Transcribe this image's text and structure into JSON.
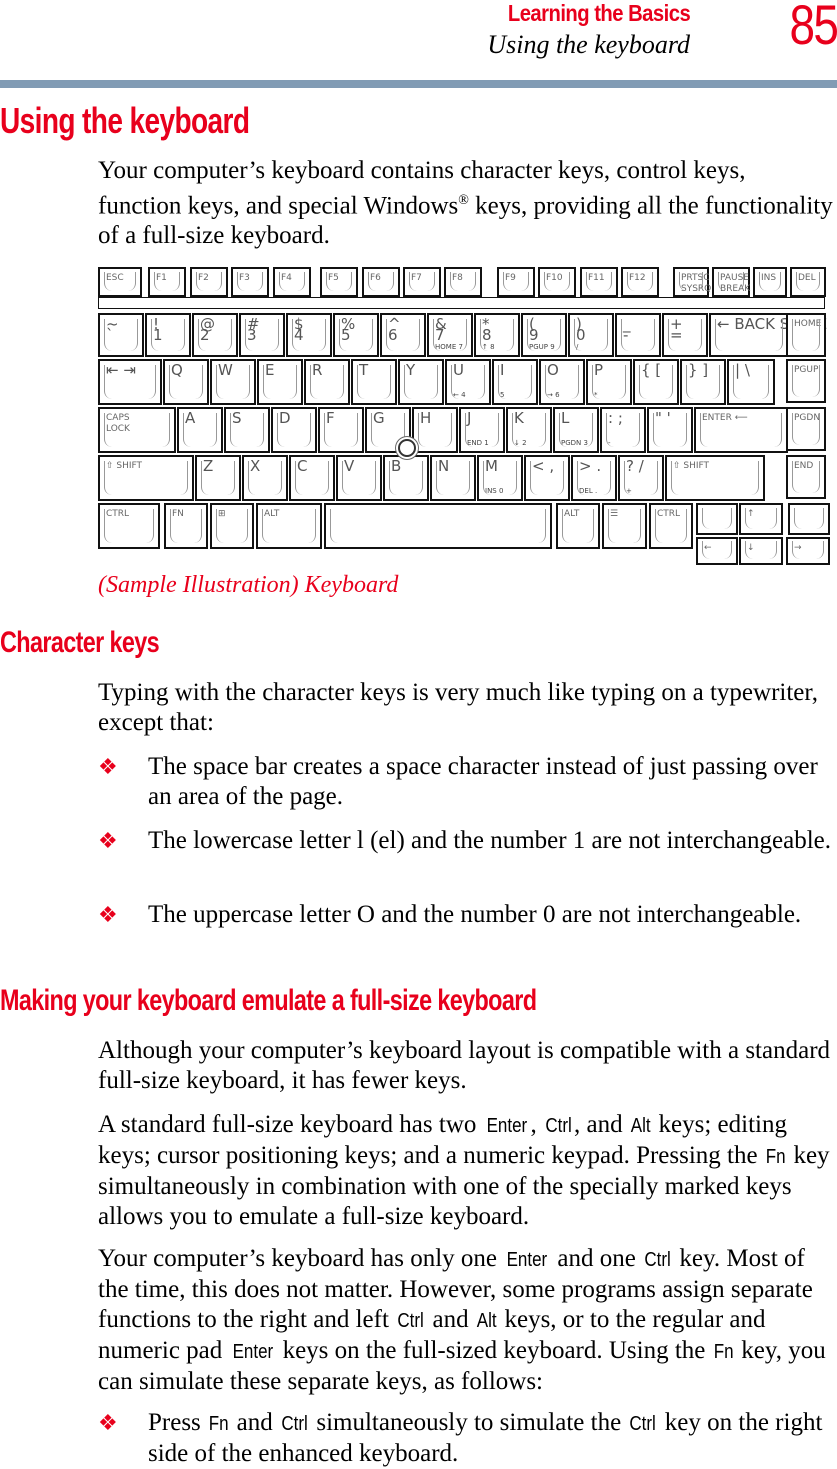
{
  "header": {
    "section": "Learning the Basics",
    "subsection": "Using the keyboard",
    "page_number": "85"
  },
  "colors": {
    "accent": "#e8001c",
    "rule": "#819bb4"
  },
  "main": {
    "title": "Using the keyboard",
    "intro_before": "Your computer’s keyboard contains character keys, control keys, function keys, and special Windows",
    "intro_reg": "®",
    "intro_after": " keys, providing all the functionality of a full-size keyboard.",
    "caption": "(Sample Illustration) Keyboard",
    "keyboard": {
      "function_row": [
        "ESC",
        "F1",
        "F2",
        "F3",
        "F4",
        "F5",
        "F6",
        "F7",
        "F8",
        "F9",
        "F10",
        "F11",
        "F12",
        "PRTSC\nSYSRQ",
        "PAUSE\nBREAK",
        "INS",
        "DEL"
      ],
      "number_row": [
        {
          "top": "~",
          "main": "`"
        },
        {
          "top": "!",
          "main": "1"
        },
        {
          "top": "@",
          "main": "2"
        },
        {
          "top": "#",
          "main": "3"
        },
        {
          "top": "$",
          "main": "4"
        },
        {
          "top": "%",
          "main": "5"
        },
        {
          "top": "^",
          "main": "6"
        },
        {
          "top": "&",
          "main": "7",
          "sub": "HOME 7"
        },
        {
          "top": "*",
          "main": "8",
          "sub": "↑ 8"
        },
        {
          "top": "(",
          "main": "9",
          "sub": "PGUP 9"
        },
        {
          "top": ")",
          "main": "0",
          "sub": "/"
        },
        {
          "top": "_",
          "main": "-"
        },
        {
          "top": "+",
          "main": "="
        },
        {
          "top": "",
          "main": "← BACK SPACE"
        }
      ],
      "qwerty_row": [
        {
          "main": "⇤ ⇥"
        },
        {
          "main": "Q"
        },
        {
          "main": "W"
        },
        {
          "main": "E"
        },
        {
          "main": "R"
        },
        {
          "main": "T"
        },
        {
          "main": "Y"
        },
        {
          "main": "U",
          "sub": "← 4"
        },
        {
          "main": "I",
          "sub": "5"
        },
        {
          "main": "O",
          "sub": "→ 6"
        },
        {
          "main": "P",
          "sub": "*"
        },
        {
          "main": "{ ["
        },
        {
          "main": "} ]"
        },
        {
          "main": "| \\"
        }
      ],
      "home_row": [
        {
          "main": "CAPS\nLOCK"
        },
        {
          "main": "A"
        },
        {
          "main": "S"
        },
        {
          "main": "D"
        },
        {
          "main": "F"
        },
        {
          "main": "G"
        },
        {
          "main": "H"
        },
        {
          "main": "J",
          "sub": "END 1"
        },
        {
          "main": "K",
          "sub": "↓ 2"
        },
        {
          "main": "L",
          "sub": "PGDN 3"
        },
        {
          "main": ": ;",
          "sub": "-"
        },
        {
          "main": "\" '"
        },
        {
          "main": "ENTER ⟵"
        }
      ],
      "shift_row": [
        {
          "main": "⇧ SHIFT"
        },
        {
          "main": "Z"
        },
        {
          "main": "X"
        },
        {
          "main": "C"
        },
        {
          "main": "V"
        },
        {
          "main": "B"
        },
        {
          "main": "N"
        },
        {
          "main": "M",
          "sub": "INS 0"
        },
        {
          "main": "< ,"
        },
        {
          "main": "> .",
          "sub": "DEL ."
        },
        {
          "main": "? /",
          "sub": "+"
        },
        {
          "main": "⇧ SHIFT"
        }
      ],
      "bottom_row": [
        "CTRL",
        "FN",
        "⊞",
        "ALT",
        "",
        "ALT",
        "☰",
        "CTRL"
      ],
      "nav_column": [
        "HOME",
        "PGUP",
        "PGDN",
        "END"
      ],
      "arrows": [
        "↑",
        "←",
        "↓",
        "→"
      ]
    },
    "sections": [
      {
        "title": "Character keys",
        "intro": "Typing with the character keys is very much like typing on a typewriter, except that:",
        "bullets": [
          "The space bar creates a space character instead of just passing over an area of the page.",
          "The lowercase letter l (el) and the number 1 are not interchangeable.",
          "The uppercase letter O and the number 0 are not interchangeable."
        ]
      },
      {
        "title": "Making your keyboard emulate a full-size keyboard",
        "p1": "Although your computer’s keyboard layout is compatible with a standard full-size keyboard, it has fewer keys.",
        "p2": {
          "a": "A standard full-size keyboard has two ",
          "enter": "Enter",
          "b": ", ",
          "ctrl": "Ctrl",
          "c": ", and ",
          "alt": "Alt",
          "d": " keys; editing keys; cursor positioning keys; and a numeric keypad. Pressing the ",
          "fn": "Fn",
          "e": " key simultaneously in combination with one of the specially marked keys allows you to emulate a full-size keyboard."
        },
        "p3": {
          "a": "Your computer’s keyboard has only one ",
          "enter": "Enter",
          "b": " and one ",
          "ctrl": "Ctrl",
          "c": " key. Most of the time, this does not matter. However, some programs assign separate functions to the right and left ",
          "ctrl2": "Ctrl",
          "d": " and ",
          "alt": "Alt",
          "e": " keys, or to the regular and numeric pad ",
          "enter2": "Enter",
          "f": " keys on the full-sized keyboard. Using the ",
          "fn": "Fn",
          "g": " key, you can simulate these separate keys, as follows:"
        },
        "bullet": {
          "a": "Press ",
          "fn": "Fn",
          "b": " and ",
          "ctrl": "Ctrl",
          "c": " simultaneously to simulate the ",
          "ctrl2": "Ctrl",
          "d": " key on the right side of the enhanced keyboard."
        },
        "bullet_mark": "❖"
      }
    ]
  }
}
